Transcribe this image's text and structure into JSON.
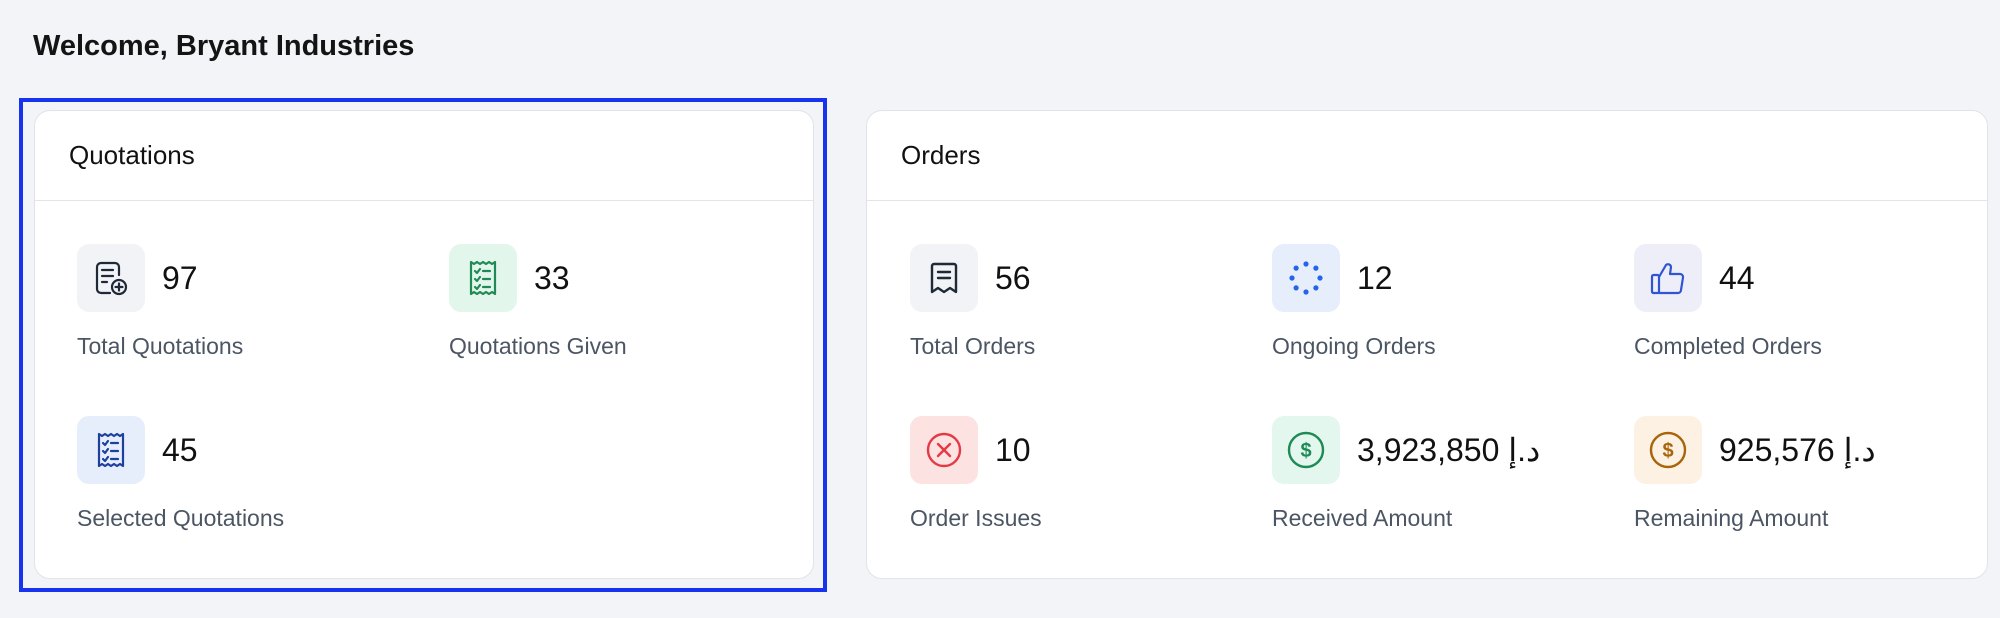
{
  "welcome": "Welcome, Bryant Industries",
  "quotations": {
    "title": "Quotations",
    "stats": [
      {
        "value": "97",
        "label": "Total Quotations",
        "icon": "document-add-icon"
      },
      {
        "value": "33",
        "label": "Quotations Given",
        "icon": "checklist-icon"
      },
      {
        "value": "45",
        "label": "Selected Quotations",
        "icon": "checklist-icon"
      }
    ]
  },
  "orders": {
    "title": "Orders",
    "stats": [
      {
        "value": "56",
        "label": "Total Orders",
        "icon": "receipt-icon"
      },
      {
        "value": "12",
        "label": "Ongoing Orders",
        "icon": "loading-icon"
      },
      {
        "value": "44",
        "label": "Completed Orders",
        "icon": "thumbs-up-icon"
      },
      {
        "value": "10",
        "label": "Order Issues",
        "icon": "x-circle-icon"
      },
      {
        "value": "3,923,850 د.إ",
        "label": "Received Amount",
        "icon": "dollar-circle-icon"
      },
      {
        "value": "925,576 د.إ",
        "label": "Remaining Amount",
        "icon": "dollar-circle-icon"
      }
    ]
  },
  "colors": {
    "highlight": "#1733ee",
    "green": "#1e8a55",
    "blue": "#1d3f9e",
    "red": "#e53945",
    "orange": "#a8650c"
  }
}
